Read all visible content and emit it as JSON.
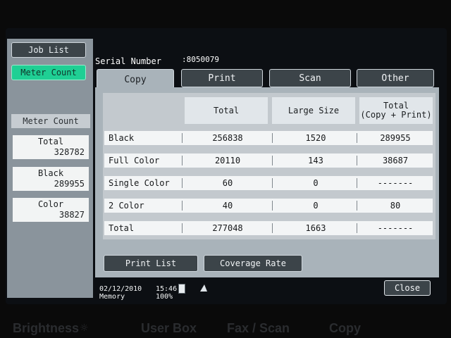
{
  "sidebar": {
    "job_list": "Job List",
    "meter_count_btn": "Meter Count",
    "heading": "Meter Count",
    "cards": [
      {
        "label": "Total",
        "value": "328782"
      },
      {
        "label": "Black",
        "value": "289955"
      },
      {
        "label": "Color",
        "value": "38827"
      }
    ]
  },
  "header": {
    "serial_label": "Serial Number",
    "serial_value": ":8050079"
  },
  "tabs": [
    "Copy",
    "Print",
    "Scan",
    "Other"
  ],
  "table": {
    "columns": [
      "Total",
      "Large Size",
      "Total\n(Copy + Print)"
    ],
    "rows": [
      {
        "name": "Black",
        "total": "256838",
        "large": "1520",
        "copy_print": "289955"
      },
      {
        "name": "Full Color",
        "total": "20110",
        "large": "143",
        "copy_print": "38687"
      },
      {
        "name": "Single Color",
        "total": "60",
        "large": "0",
        "copy_print": "-------"
      },
      {
        "name": "2 Color",
        "total": "40",
        "large": "0",
        "copy_print": "80"
      },
      {
        "name": "Total",
        "total": "277048",
        "large": "1663",
        "copy_print": "-------"
      }
    ]
  },
  "actions": {
    "print_list": "Print List",
    "coverage_rate": "Coverage Rate"
  },
  "status": {
    "date": "02/12/2010",
    "time": "15:46",
    "memory_label": "Memory",
    "memory_value": "100%"
  },
  "close": "Close",
  "bezel": {
    "brightness": "Brightness",
    "user_box": "User Box",
    "fax_scan": "Fax / Scan",
    "copy": "Copy"
  }
}
